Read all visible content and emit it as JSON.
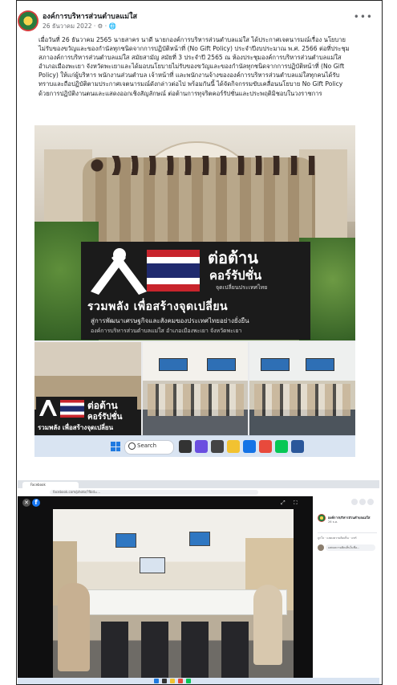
{
  "post": {
    "page_name": "องค์การบริหารส่วนตำบลแม่ใส",
    "date": "26 ธันวาคม 2022 · ⚙ · 🌐",
    "more": "•••",
    "body": "เมื่อวันที่ 26 ธันวาคม 2565 นายสาคร นาดี นายกองค์การบริหารส่วนตำบลแม่ใส ได้ประกาศเจตนารมณ์เรื่อง นโยบายไม่รับของขวัญและของกำนัลทุกชนิดจากการปฏิบัติหน้าที่ (No Gift Policy) ประจำปีงบประมาณ พ.ศ. 2566 ต่อที่ประชุมสภาองค์การบริหารส่วนตำบลแม่ใส สมัยสามัญ สมัยที่ 3 ประจำปี 2565 ณ ห้องประชุมองค์การบริหารส่วนตำบลแม่ใส อำเภอเมืองพะเยา จังหวัดพะเยาและได้มอบนโยบายไม่รับของขวัญและของกำนัลทุกชนิดจากการปฏิบัติหน้าที่ (No Gift Policy) ให้แก่ผู้บริหาร พนักงานส่วนตำบล เจ้าหน้าที่ และพนักงานจ้างขององค์การบริหารส่วนตำบลแม่ใสทุกคนได้รับทราบและถือปฏิบัติตามประกาศเจตนารมณ์ดังกล่าวต่อไป พร้อมกันนี้ ได้จัดกิจกรรมขับเคลื่อนนโยบาย No Gift Policy ด้วยการปฏิบัติงานตนและแสดงออกเชิงสัญลักษณ์ ต่อต้านการทุจริตคอร์รัปชั่นและประพฤติมิชอบในวงราชการ"
  },
  "banner": {
    "title1": "ต่อต้าน",
    "title2": "คอร์รัปชั่น",
    "subtitle": "จุดเปลี่ยนประเทศไทย",
    "slogan": "รวมพลัง เพื่อสร้างจุดเปลี่ยน",
    "line2": "สู่การพัฒนาเศรษฐกิจและสังคมของประเทศไทยอย่างยั่งยืน",
    "line3": "องค์การบริหารส่วนตำบลแม่ใส อำเภอเมืองพะเยา จังหวัดพะเยา"
  },
  "mini_banner": {
    "title1": "ต่อต้าน",
    "title2": "คอร์รัปชั่น",
    "slogan": "รวมพลัง เพื่อสร้างจุดเปลี่ยน"
  },
  "taskbar": {
    "search_label": "Search"
  },
  "browser": {
    "tab_label": "Facebook",
    "url": "facebook.com/photo/?fbid=...",
    "close": "✕",
    "fb": "f",
    "tools": "⤢ ⛶"
  },
  "side_panel": {
    "page_name": "องค์การบริหารส่วนตำบลแม่ใส",
    "date": "26 ธ.ค.",
    "actions": "ถูกใจ · แสดงความคิดเห็น · แชร์",
    "comment_placeholder": "แสดงความคิดเห็นในชื่อ..."
  }
}
